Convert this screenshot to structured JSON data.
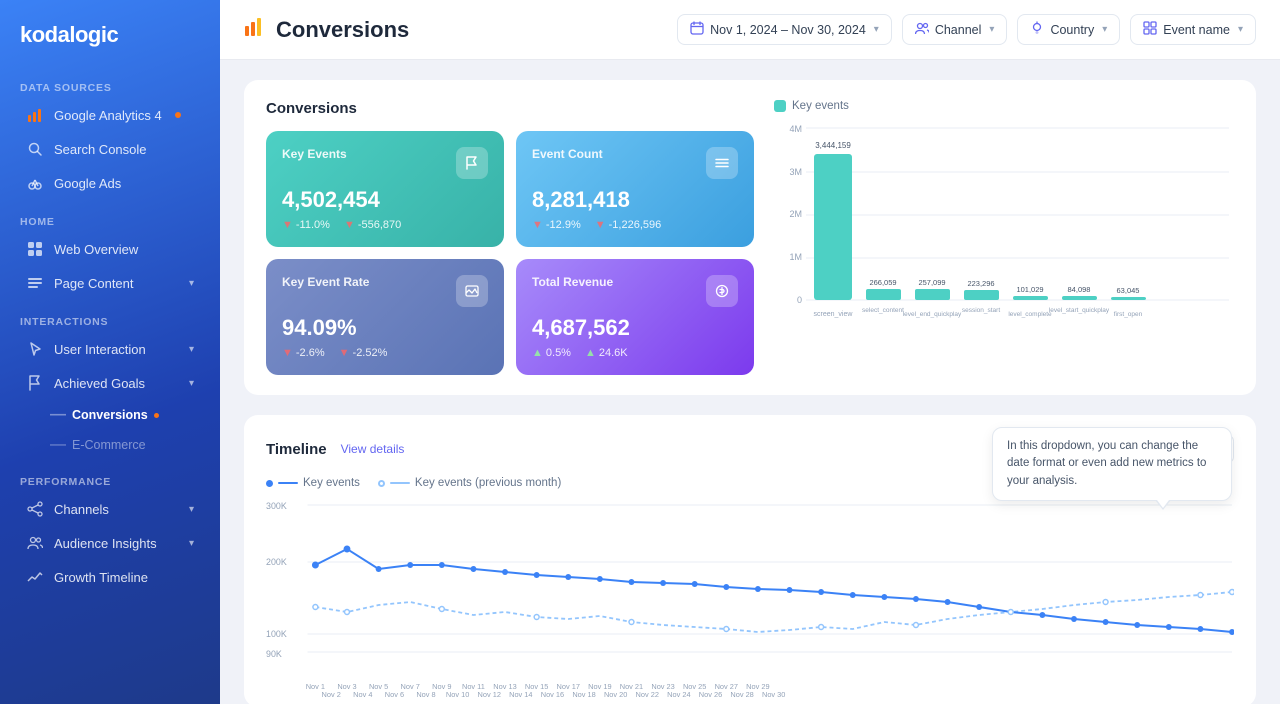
{
  "sidebar": {
    "logo": "kodalogic",
    "sections": [
      {
        "label": "Data Sources",
        "items": [
          {
            "id": "google-analytics",
            "label": "Google Analytics 4",
            "dot": true,
            "icon": "chart-bar"
          },
          {
            "id": "search-console",
            "label": "Search Console",
            "icon": "search"
          },
          {
            "id": "google-ads",
            "label": "Google Ads",
            "icon": "ads"
          }
        ]
      },
      {
        "label": "Home",
        "items": [
          {
            "id": "web-overview",
            "label": "Web Overview",
            "icon": "grid"
          },
          {
            "id": "page-content",
            "label": "Page Content",
            "icon": "list",
            "hasChevron": true
          }
        ]
      },
      {
        "label": "Interactions",
        "items": [
          {
            "id": "user-interaction",
            "label": "User Interaction",
            "icon": "cursor",
            "hasChevron": true
          },
          {
            "id": "achieved-goals",
            "label": "Achieved Goals",
            "icon": "flag",
            "hasChevron": true,
            "expanded": true,
            "children": [
              {
                "id": "conversions",
                "label": "Conversions",
                "dot": true,
                "active": true
              },
              {
                "id": "e-commerce",
                "label": "E-Commerce",
                "inactive": true
              }
            ]
          }
        ]
      },
      {
        "label": "Performance",
        "items": [
          {
            "id": "channels",
            "label": "Channels",
            "icon": "share",
            "hasChevron": true
          },
          {
            "id": "audience-insights",
            "label": "Audience Insights",
            "icon": "people",
            "hasChevron": true
          },
          {
            "id": "growth-timeline",
            "label": "Growth Timeline",
            "icon": "trending"
          }
        ]
      }
    ]
  },
  "topbar": {
    "title": "Conversions",
    "filters": [
      {
        "id": "date-filter",
        "icon": "calendar",
        "label": "Nov 1, 2024 – Nov 30, 2024"
      },
      {
        "id": "channel-filter",
        "icon": "people-two",
        "label": "Channel"
      },
      {
        "id": "country-filter",
        "icon": "location",
        "label": "Country"
      },
      {
        "id": "event-filter",
        "icon": "grid-four",
        "label": "Event name"
      }
    ]
  },
  "conversions_panel": {
    "title": "Conversions",
    "metrics": [
      {
        "id": "key-events",
        "label": "Key Events",
        "value": "4,502,454",
        "change_pct": "-11.0%",
        "change_abs": "-556,870",
        "color": "teal",
        "icon": "flag"
      },
      {
        "id": "event-count",
        "label": "Event Count",
        "value": "8,281,418",
        "change_pct": "-12.9%",
        "change_abs": "-1,226,596",
        "color": "sky",
        "icon": "menu"
      },
      {
        "id": "key-event-rate",
        "label": "Key Event Rate",
        "value": "94.09%",
        "change_pct": "-2.6%",
        "change_abs": "-2.52%",
        "color": "slate",
        "icon": "image"
      },
      {
        "id": "total-revenue",
        "label": "Total Revenue",
        "value": "4,687,562",
        "change_pct": "0.5%",
        "change_abs": "24.6K",
        "up": true,
        "color": "purple",
        "icon": "money"
      }
    ]
  },
  "bar_chart": {
    "legend": "Key events",
    "y_labels": [
      "4M",
      "3M",
      "2M",
      "1M",
      "0"
    ],
    "top_value": "3,444,159",
    "bars": [
      {
        "label": "screen_view",
        "sublabel": "",
        "value": 3444159,
        "height_pct": 100
      },
      {
        "label": "select_content",
        "sublabel": "",
        "value": 266059,
        "height_pct": 7.7
      },
      {
        "label": "level_end_quickplay",
        "sublabel": "",
        "value": 257099,
        "height_pct": 7.5
      },
      {
        "label": "session_start",
        "sublabel": "",
        "value": 223296,
        "height_pct": 6.5
      },
      {
        "label": "level_complete",
        "sublabel": "",
        "value": 101029,
        "height_pct": 2.9
      },
      {
        "label": "level_start_quickplay",
        "sublabel": "",
        "value": 84098,
        "height_pct": 2.4
      },
      {
        "label": "first_open",
        "sublabel": "",
        "value": 63045,
        "height_pct": 1.8
      }
    ]
  },
  "timeline": {
    "title": "Timeline",
    "view_details": "View details",
    "tooltip": "In this dropdown, you can change the date format or even add new metrics to your analysis.",
    "legend": [
      {
        "label": "Key events",
        "color": "#3b82f6",
        "type": "solid"
      },
      {
        "label": "Key events (previous month)",
        "color": "#93c5fd",
        "type": "dashed"
      }
    ],
    "y_labels": [
      "300K",
      "200K",
      "100K",
      "90K"
    ],
    "x_labels": [
      "Nov 1",
      "Nov 3",
      "Nov 5",
      "Nov 7",
      "Nov 9",
      "Nov 11",
      "Nov 13",
      "Nov 15",
      "Nov 17",
      "Nov 19",
      "Nov 21",
      "Nov 23",
      "Nov 25",
      "Nov 27",
      "Nov 29",
      "Nov 2",
      "Nov 4",
      "Nov 6",
      "Nov 8",
      "Nov 10",
      "Nov 12",
      "Nov 14",
      "Nov 16",
      "Nov 18",
      "Nov 20",
      "Nov 22",
      "Nov 24",
      "Nov 26",
      "Nov 28",
      "Nov 30"
    ]
  }
}
